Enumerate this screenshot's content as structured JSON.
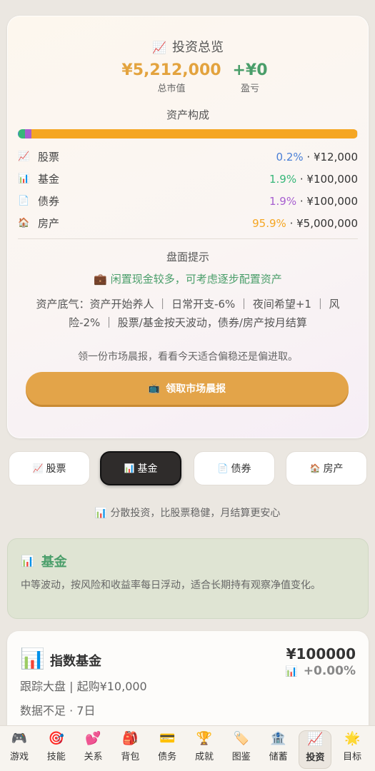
{
  "overview": {
    "title": "投资总览",
    "title_icon": "📈",
    "total_value": "¥5,212,000",
    "total_label": "总市值",
    "profit": "+¥0",
    "profit_label": "盈亏",
    "composition_label": "资产构成",
    "allocation": [
      {
        "name": "股票",
        "icon": "📈",
        "pct": "0.2%",
        "amount": "· ¥12,000",
        "color": "#4a7fd6",
        "share": 0.2
      },
      {
        "name": "基金",
        "icon": "📊",
        "pct": "1.9%",
        "amount": "· ¥100,000",
        "color": "#37b779",
        "share": 1.9
      },
      {
        "name": "债券",
        "icon": "📄",
        "pct": "1.9%",
        "amount": "· ¥100,000",
        "color": "#a75fd0",
        "share": 1.9
      },
      {
        "name": "房产",
        "icon": "🏠",
        "pct": "95.9%",
        "amount": "· ¥5,000,000",
        "color": "#f5a623",
        "share": 95.9
      }
    ],
    "hint_label": "盘面提示",
    "hint_icon": "💼",
    "hint_text": "闲置现金较多，可考虑逐步配置资产",
    "hint_detail": "资产底气：资产开始养人 ｜ 日常开支-6% ｜ 夜间希望+1 ｜ 风险-2% ｜ 股票/基金按天波动，债券/房产按月结算",
    "morning_prompt": "领一份市场晨报，看看今天适合偏稳还是偏进取。",
    "morning_button_icon": "📺",
    "morning_button": "领取市场晨报"
  },
  "tabs": [
    {
      "icon": "📈",
      "label": "股票",
      "active": false
    },
    {
      "icon": "📊",
      "label": "基金",
      "active": true
    },
    {
      "icon": "📄",
      "label": "债券",
      "active": false
    },
    {
      "icon": "🏠",
      "label": "房产",
      "active": false
    }
  ],
  "subtitle_icon": "📊",
  "subtitle": "分散投资，比股票稳健，月结算更安心",
  "fund_info": {
    "icon": "📊",
    "title": "基金",
    "description": "中等波动，按风险和收益率每日浮动，适合长期持有观察净值变化。"
  },
  "product": {
    "icon": "📊",
    "name": "指数基金",
    "desc": "跟踪大盘 | 起购¥10,000",
    "meta": "数据不足 · 7日",
    "price": "¥100000",
    "change_icon": "📊",
    "change": "+0.00%"
  },
  "bottom_nav": [
    {
      "icon": "🎮",
      "label": "游戏",
      "active": false
    },
    {
      "icon": "🎯",
      "label": "技能",
      "active": false
    },
    {
      "icon": "💕",
      "label": "关系",
      "active": false
    },
    {
      "icon": "🎒",
      "label": "背包",
      "active": false
    },
    {
      "icon": "💳",
      "label": "债务",
      "active": false
    },
    {
      "icon": "🏆",
      "label": "成就",
      "active": false
    },
    {
      "icon": "🏷️",
      "label": "图鉴",
      "active": false
    },
    {
      "icon": "🏦",
      "label": "储蓄",
      "active": false
    },
    {
      "icon": "📈",
      "label": "投资",
      "active": true
    },
    {
      "icon": "🌟",
      "label": "目标",
      "active": false
    }
  ]
}
